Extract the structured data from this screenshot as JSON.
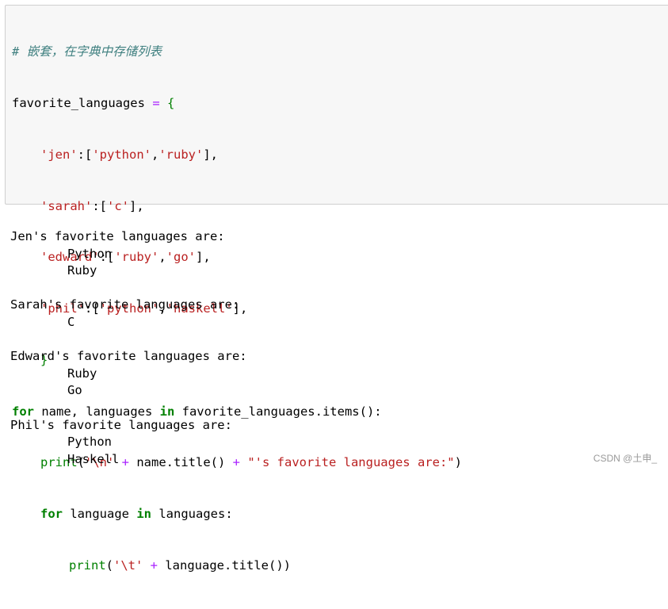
{
  "code": {
    "comment": "# 嵌套，在字典中存储列表",
    "var_name": "favorite_languages",
    "assign": " = ",
    "open_brace": "{",
    "entries": [
      {
        "key": "'jen'",
        "colon": ":[",
        "values": [
          "'python'",
          "'ruby'"
        ],
        "close": "],"
      },
      {
        "key": "'sarah'",
        "colon": ":[",
        "values": [
          "'c'"
        ],
        "close": "],"
      },
      {
        "key": "'edward'",
        "colon": ":[",
        "values": [
          "'ruby'",
          "'go'"
        ],
        "close": "],"
      },
      {
        "key": "'phil'",
        "colon": ":[",
        "values": [
          "'python'",
          "'haskell'"
        ],
        "close": "],"
      }
    ],
    "close_brace": "}",
    "for1_kw": "for",
    "for1_vars": " name, languages ",
    "in_kw": "in",
    "for1_iter": " favorite_languages.items():",
    "print1_fn": "print",
    "print1_open": "(",
    "print1_str1": "'\\n'",
    "plus": " + ",
    "print1_mid": "name.title()",
    "print1_str2": "\"'s favorite languages are:\"",
    "print1_close": ")",
    "for2_kw": "for",
    "for2_var": " language ",
    "for2_iter": " languages:",
    "print2_fn": "print",
    "print2_open": "(",
    "print2_str": "'\\t'",
    "print2_mid": "language.title()",
    "print2_close": ")"
  },
  "output": {
    "lines": [
      {
        "text": "Jen's favorite languages are:",
        "indent": false
      },
      {
        "text": "Python",
        "indent": true
      },
      {
        "text": "Ruby",
        "indent": true
      },
      {
        "text": "",
        "indent": false
      },
      {
        "text": "Sarah's favorite languages are:",
        "indent": false
      },
      {
        "text": "C",
        "indent": true
      },
      {
        "text": "",
        "indent": false
      },
      {
        "text": "Edward's favorite languages are:",
        "indent": false
      },
      {
        "text": "Ruby",
        "indent": true
      },
      {
        "text": "Go",
        "indent": true
      },
      {
        "text": "",
        "indent": false
      },
      {
        "text": "Phil's favorite languages are:",
        "indent": false
      },
      {
        "text": "Python",
        "indent": true
      },
      {
        "text": "Haskell",
        "indent": true
      }
    ]
  },
  "watermark": "CSDN @土申_",
  "colors": {
    "comment": "#408080",
    "keyword": "#008000",
    "operator": "#aa22ff",
    "string": "#ba2121",
    "cell_bg": "#f7f7f7",
    "cell_border": "#cfcfcf"
  }
}
